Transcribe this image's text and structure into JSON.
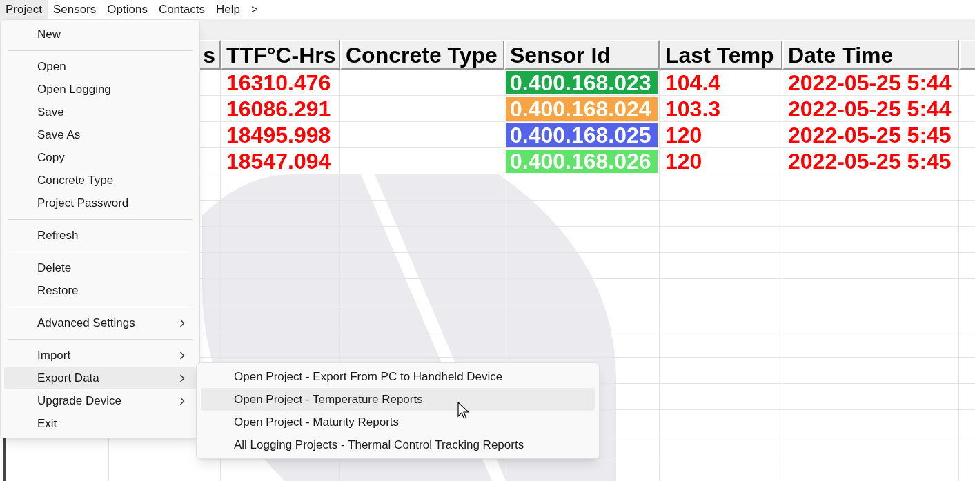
{
  "menu_bar": [
    {
      "label": "Project",
      "selected": true
    },
    {
      "label": "Sensors",
      "selected": false
    },
    {
      "label": "Options",
      "selected": false
    },
    {
      "label": "Contacts",
      "selected": false
    },
    {
      "label": "Help",
      "selected": false
    },
    {
      "label": ">",
      "selected": false
    }
  ],
  "grid": {
    "columns": [
      {
        "header": "s"
      },
      {
        "header": "TTF°C-Hrs"
      },
      {
        "header": "Concrete Type"
      },
      {
        "header": "Sensor Id"
      },
      {
        "header": "Last Temp"
      },
      {
        "header": "Date Time"
      }
    ],
    "rows": [
      {
        "ttf": "16310.476",
        "sensor_id": "0.400.168.023",
        "color": "#1aaa4a",
        "last_temp": "104.4",
        "date_time": "2022-05-25 5:44"
      },
      {
        "ttf": "16086.291",
        "sensor_id": "0.400.168.024",
        "color": "#f7a444",
        "last_temp": "103.3",
        "date_time": "2022-05-25 5:44"
      },
      {
        "ttf": "18495.998",
        "sensor_id": "0.400.168.025",
        "color": "#5563ea",
        "last_temp": "120",
        "date_time": "2022-05-25 5:45"
      },
      {
        "ttf": "18547.094",
        "sensor_id": "0.400.168.026",
        "color": "#5fe36a",
        "last_temp": "120",
        "date_time": "2022-05-25 5:45"
      }
    ]
  },
  "project_menu": {
    "items": [
      {
        "kind": "item",
        "label": "New",
        "selected": false
      },
      {
        "kind": "separator"
      },
      {
        "kind": "item",
        "label": "Open",
        "selected": false
      },
      {
        "kind": "item",
        "label": "Open Logging",
        "selected": false
      },
      {
        "kind": "item",
        "label": "Save",
        "selected": false
      },
      {
        "kind": "item",
        "label": "Save As",
        "selected": false
      },
      {
        "kind": "item",
        "label": "Copy",
        "selected": false
      },
      {
        "kind": "item",
        "label": "Concrete Type",
        "selected": false
      },
      {
        "kind": "item",
        "label": "Project Password",
        "selected": false
      },
      {
        "kind": "separator"
      },
      {
        "kind": "item",
        "label": "Refresh",
        "selected": false
      },
      {
        "kind": "separator"
      },
      {
        "kind": "item",
        "label": "Delete",
        "selected": false
      },
      {
        "kind": "item",
        "label": "Restore",
        "selected": false
      },
      {
        "kind": "separator"
      },
      {
        "kind": "submenu",
        "label": "Advanced Settings",
        "selected": false
      },
      {
        "kind": "separator"
      },
      {
        "kind": "submenu",
        "label": "Import",
        "selected": false
      },
      {
        "kind": "submenu",
        "label": "Export Data",
        "selected": true
      },
      {
        "kind": "submenu",
        "label": "Upgrade Device",
        "selected": false
      },
      {
        "kind": "item",
        "label": "Exit",
        "selected": false
      }
    ]
  },
  "export_submenu": {
    "items": [
      {
        "label": "Open Project - Export From PC to Handheld Device",
        "selected": false
      },
      {
        "label": "Open Project - Temperature Reports",
        "selected": true
      },
      {
        "label": "Open Project - Maturity Reports",
        "selected": false
      },
      {
        "label": "All Logging Projects - Thermal Control Tracking Reports",
        "selected": false
      }
    ]
  }
}
